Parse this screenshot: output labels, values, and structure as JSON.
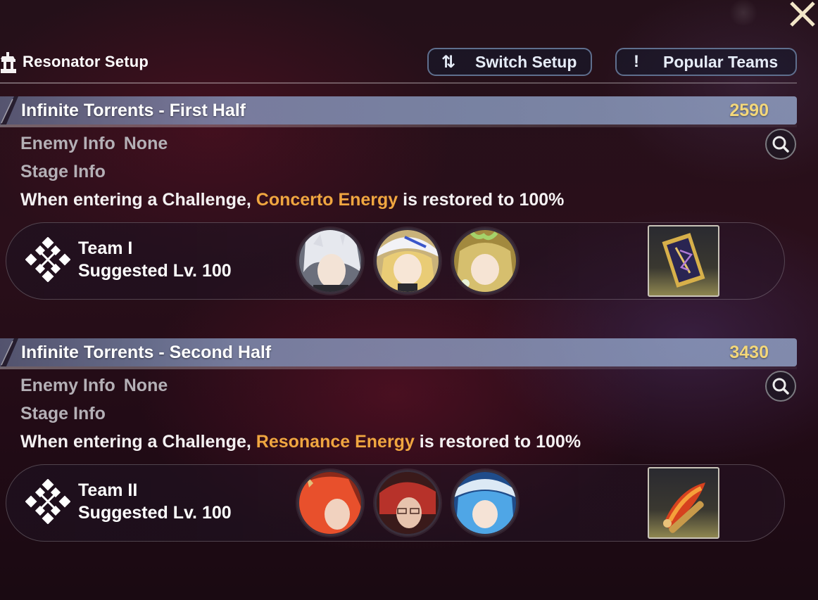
{
  "header": {
    "title": "Resonator Setup",
    "switch_label": "Switch Setup",
    "switch_icon": "swap-arrows-icon",
    "popular_label": "Popular Teams",
    "popular_icon": "exclamation-icon"
  },
  "stages": [
    {
      "title": "Infinite Torrents - First Half",
      "score": "2590",
      "enemy_label": "Enemy Info",
      "enemy_value": "None",
      "stage_label": "Stage Info",
      "desc_prefix": "When entering a Challenge, ",
      "desc_highlight": "Concerto Energy",
      "desc_suffix": " is restored to 100%",
      "team": {
        "name": "Team I",
        "level": "Suggested Lv. 100",
        "resonators": [
          "silver-hair-resonator-avatar",
          "blonde-hat-resonator-avatar",
          "green-leaf-resonator-avatar"
        ],
        "echo": "hourglass-frame-echo"
      }
    },
    {
      "title": "Infinite Torrents - Second Half",
      "score": "3430",
      "enemy_label": "Enemy Info",
      "enemy_value": "None",
      "stage_label": "Stage Info",
      "desc_prefix": "When entering a Challenge, ",
      "desc_highlight": "Resonance Energy",
      "desc_suffix": " is restored to 100%",
      "team": {
        "name": "Team II",
        "level": "Suggested Lv. 100",
        "resonators": [
          "orange-hair-resonator-avatar",
          "red-hair-glasses-resonator-avatar",
          "blue-hair-resonator-avatar"
        ],
        "echo": "flaming-spyglass-echo"
      }
    }
  ],
  "colors": {
    "highlight": "#f0a640",
    "score": "#f3d77a",
    "banner": "#96a8cd"
  }
}
